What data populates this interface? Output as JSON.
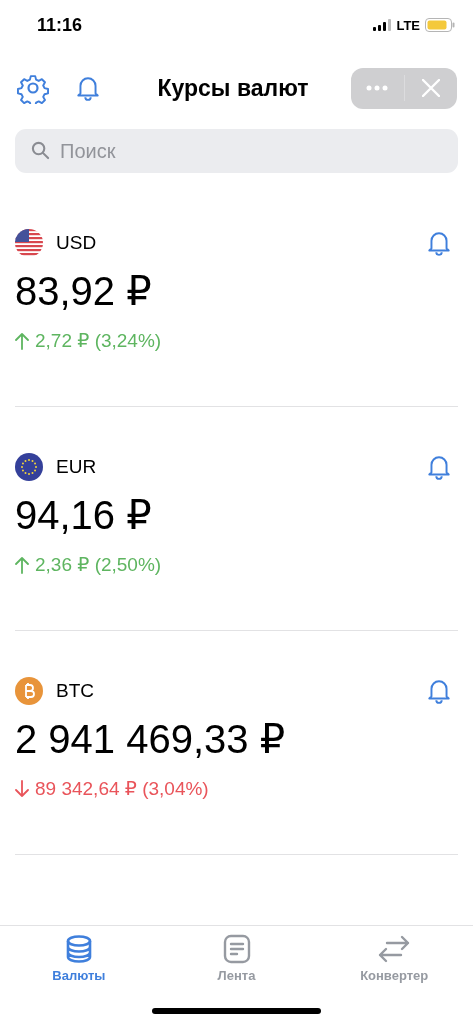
{
  "status_bar": {
    "time": "11:16",
    "network": "LTE"
  },
  "header": {
    "title": "Курсы валют"
  },
  "search": {
    "placeholder": "Поиск"
  },
  "currencies": [
    {
      "kind": "usd",
      "code": "USD",
      "price": "83,92 ₽",
      "rising": true,
      "change": "2,72 ₽ (3,24%)"
    },
    {
      "kind": "eur",
      "code": "EUR",
      "price": "94,16 ₽",
      "rising": true,
      "change": "2,36 ₽ (2,50%)"
    },
    {
      "kind": "btc",
      "code": "BTC",
      "price": "2 941 469,33 ₽",
      "rising": false,
      "change": "89 342,64 ₽ (3,04%)"
    }
  ],
  "tabs": [
    {
      "kind": "currencies",
      "label": "Валюты",
      "selected": true
    },
    {
      "kind": "feed",
      "label": "Лента",
      "selected": false
    },
    {
      "kind": "converter",
      "label": "Конвертер",
      "selected": false
    }
  ]
}
